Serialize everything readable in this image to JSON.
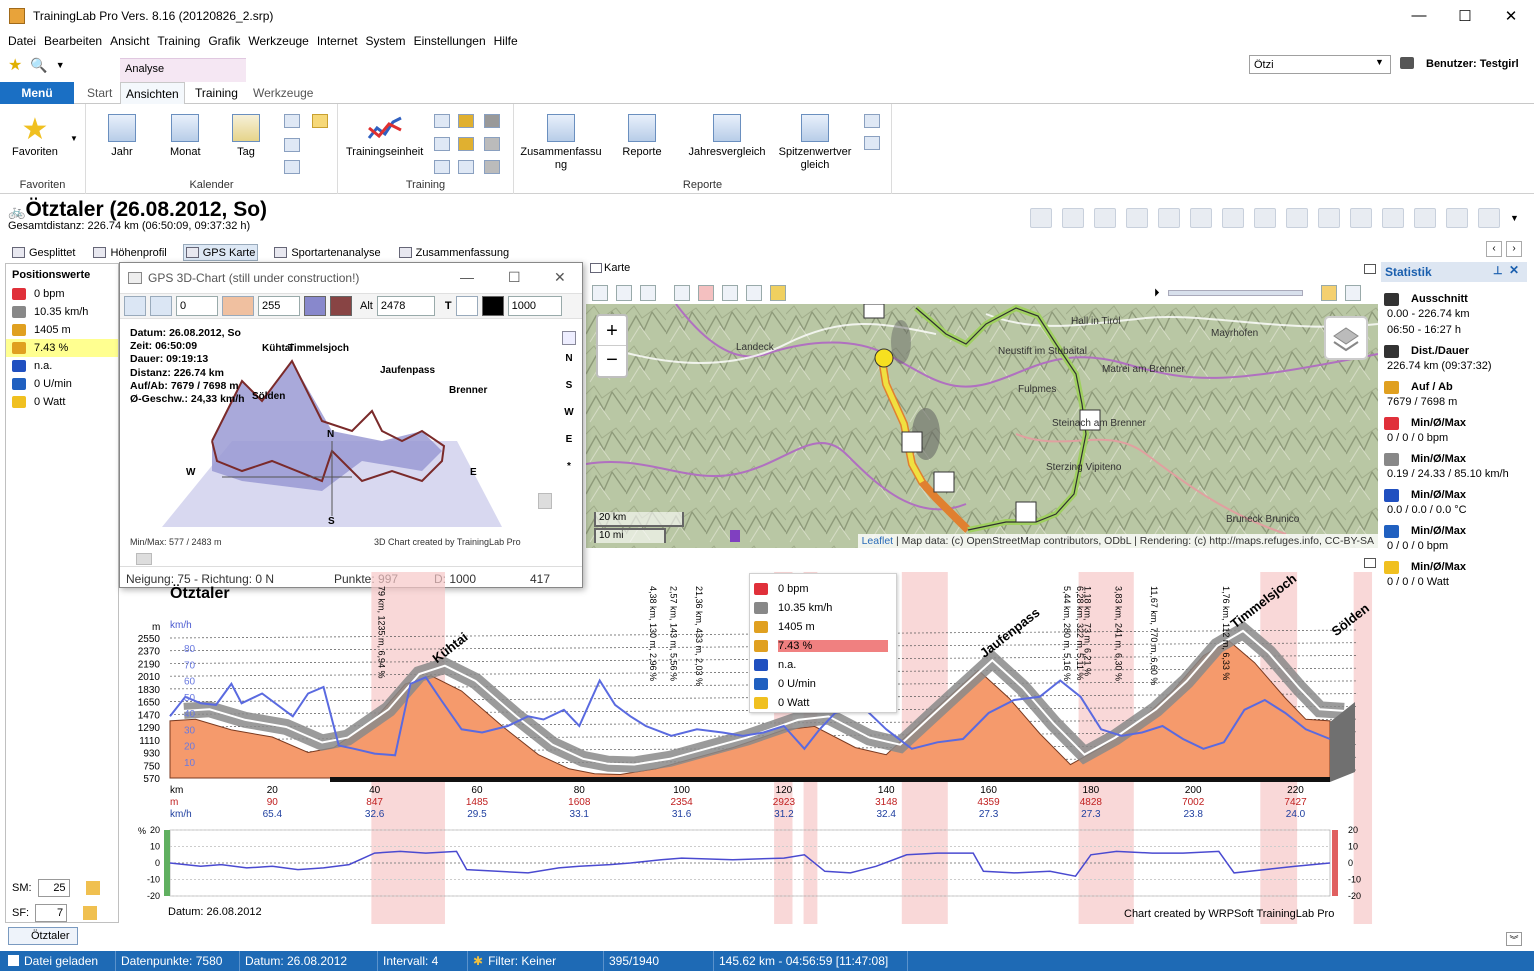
{
  "window": {
    "title": "TrainingLab Pro Vers. 8.16 (20120826_2.srp)",
    "min": "—",
    "max": "☐",
    "close": "✕"
  },
  "menu": [
    "Datei",
    "Bearbeiten",
    "Ansicht",
    "Training",
    "Grafik",
    "Werkzeuge",
    "Internet",
    "System",
    "Einstellungen",
    "Hilfe"
  ],
  "ribbon": {
    "context_tab": "Analyse",
    "menu_tab": "Menü",
    "tabs": [
      "Start",
      "Ansichten",
      "Training",
      "Werkzeuge"
    ],
    "groups": {
      "favoriten": {
        "label": "Favoriten",
        "button": "Favoriten"
      },
      "kalender": {
        "label": "Kalender",
        "buttons": [
          "Jahr",
          "Monat",
          "Tag"
        ]
      },
      "training": {
        "label": "Training",
        "button": "Trainingseinheit"
      },
      "reporte": {
        "label": "Reporte",
        "buttons": [
          "Zusammenfassu ng",
          "Reporte",
          "Jahresvergleich",
          "Spitzenwertver gleich"
        ]
      }
    },
    "athlete_combo": "Ötzi",
    "user": "Benutzer: Testgirl"
  },
  "header": {
    "title": "Ötztaler (26.08.2012, So)",
    "subtitle": "Gesamtdistanz: 226.74 km (06:50:09, 09:37:32 h)",
    "tabs": [
      "Gesplittet",
      "Höhenprofil",
      "GPS Karte",
      "Sportartenanalyse",
      "Zusammenfassung"
    ],
    "active_tab": "GPS Karte"
  },
  "positionswerte": {
    "title": "Positionswerte",
    "items": [
      {
        "icon": "heart-icon",
        "value": "0 bpm",
        "color": "#e0303a"
      },
      {
        "icon": "speedometer-icon",
        "value": "10.35 km/h",
        "color": "#888888"
      },
      {
        "icon": "altitude-icon",
        "value": "1405 m",
        "color": "#e0a020"
      },
      {
        "icon": "gradient-icon",
        "value": "7.43 %",
        "color": "#e0a020",
        "highlight": true
      },
      {
        "icon": "temperature-icon",
        "value": "n.a.",
        "color": "#2050c0"
      },
      {
        "icon": "cadence-icon",
        "value": "0 U/min",
        "color": "#2060c0"
      },
      {
        "icon": "power-icon",
        "value": "0 Watt",
        "color": "#f0c020"
      }
    ],
    "sm_label": "SM:",
    "sm_value": "25",
    "sf_label": "SF:",
    "sf_value": "7",
    "bottom_tab": "Ötztaler"
  },
  "chart3d": {
    "title": "GPS 3D-Chart (still under construction!)",
    "input1": "0",
    "input2": "255",
    "alt_label": "Alt",
    "alt_value": "2478",
    "t_label": "T",
    "size_value": "1000",
    "color1": "#8888cc",
    "color2": "#884444",
    "color3": "#000000",
    "info": [
      "Datum: 26.08.2012, So",
      "Zeit: 06:50:09",
      "Dauer: 09:19:13",
      "Distanz: 226.74 km",
      "Auf/Ab: 7679 / 7698 m",
      "Ø-Geschw.: 24,33 km/h"
    ],
    "places": [
      "Kühtai",
      "Timmelsjoch",
      "Jaufenpass",
      "Brenner",
      "Sölden"
    ],
    "compass": [
      "N",
      "W",
      "E",
      "S"
    ],
    "side_compass": [
      "N",
      "S",
      "W",
      "E",
      "*"
    ],
    "minmax": "Min/Max: 577 / 2483 m",
    "credit": "3D Chart created by TrainingLab Pro",
    "status": {
      "neigung": "Neigung: 75 - Richtung: 0 N",
      "punkte": "Punkte: 997",
      "d": "D: 1000",
      "n": "417"
    }
  },
  "map": {
    "title": "Karte",
    "zoom_in": "+",
    "zoom_out": "−",
    "scale_km": "20 km",
    "scale_mi": "10 mi",
    "places": [
      "Landeck",
      "Hall in Tirol",
      "Mayrhofen",
      "Neustift im Stubaital",
      "Fulpmes",
      "Matrei am Brenner",
      "Steinach am Brenner",
      "Sterzing Vipiteno",
      "Bruneck Brunico"
    ],
    "attribution_link": "Leaflet",
    "attribution": " | Map data: (c) OpenStreetMap contributors, ODbL | Rendering: (c) http://maps.refuges.info, CC-BY-SA"
  },
  "statistik": {
    "title": "Statistik",
    "rows": [
      {
        "label": "Ausschnitt",
        "icon": "range-icon",
        "color": "#333333",
        "values": [
          "0.00 - 226.74 km",
          "06:50 - 16:27 h"
        ]
      },
      {
        "label": "Dist./Dauer",
        "icon": "finish-flag-icon",
        "color": "#333333",
        "values": [
          "226.74 km (09:37:32)"
        ]
      },
      {
        "label": "Auf / Ab",
        "icon": "altitude-icon",
        "color": "#e0a020",
        "values": [
          "7679 / 7698 m"
        ]
      },
      {
        "label": "Min/Ø/Max",
        "icon": "heart-icon",
        "color": "#e0303a",
        "values": [
          "0 / 0 / 0 bpm"
        ]
      },
      {
        "label": "Min/Ø/Max",
        "icon": "speedometer-icon",
        "color": "#888888",
        "values": [
          "0.19 / 24.33 / 85.10 km/h"
        ]
      },
      {
        "label": "Min/Ø/Max",
        "icon": "temperature-icon",
        "color": "#2050c0",
        "values": [
          "0.0 / 0.0 / 0.0 °C"
        ]
      },
      {
        "label": "Min/Ø/Max",
        "icon": "cadence-icon",
        "color": "#2060c0",
        "values": [
          "0 / 0 / 0 bpm"
        ]
      },
      {
        "label": "Min/Ø/Max",
        "icon": "power-icon",
        "color": "#f0c020",
        "values": [
          "0 / 0 / 0 Watt"
        ]
      }
    ]
  },
  "elevation": {
    "title": "Ötztaler",
    "unit_m": "m",
    "unit_kmh": "km/h",
    "y_alt": [
      "2550",
      "2370",
      "2190",
      "2010",
      "1830",
      "1650",
      "1470",
      "1290",
      "1110",
      "930",
      "750",
      "570"
    ],
    "y_speed": [
      "80",
      "70",
      "60",
      "50",
      "40",
      "30",
      "20",
      "10"
    ],
    "x_km": [
      "20",
      "40",
      "60",
      "80",
      "100",
      "120",
      "140",
      "160",
      "180",
      "200",
      "220"
    ],
    "row_labels": [
      "km",
      "m",
      "km/h"
    ],
    "row_m": [
      "90",
      "847",
      "1485",
      "1608",
      "2354",
      "2923",
      "3148",
      "4359",
      "4828",
      "7002",
      "7427"
    ],
    "row_kmh": [
      "65.4",
      "32.6",
      "29.5",
      "33.1",
      "31.6",
      "31.2",
      "32.4",
      "27.3",
      "27.3",
      "23.8",
      "24.0"
    ],
    "passes": [
      "Kühtai",
      "Jaufenpass",
      "Timmelsjoch",
      "Sölden"
    ],
    "segments": [
      "79 km, 1235 m, 6,94 %",
      "4,38 km, 130 m, 2,96 %",
      "2,57 km, 143 m, 5,56 %",
      "21,36 km, 433 m, 2,03 %",
      "5,44 km, 280 m, 5,16 %",
      "6,28 km, 322 m, 5,11 %",
      "1,18 km, 73 m, 6,21 %",
      "3,83 km, 241 m, 6,30 %",
      "11,67 km, 770 m, 6,60 %",
      "1,76 km, 112 m, 6,33 %"
    ],
    "grad_y": [
      "20",
      "10",
      "0",
      "-10",
      "-20"
    ],
    "grad_unit": "%",
    "date": "Datum: 26.08.2012",
    "credit": "Chart created by WRPSoft TrainingLab Pro",
    "tooltip": [
      {
        "icon": "heart-icon",
        "value": "0 bpm",
        "color": "#e0303a"
      },
      {
        "icon": "speedometer-icon",
        "value": "10.35 km/h",
        "color": "#888888"
      },
      {
        "icon": "altitude-icon",
        "value": "1405 m",
        "color": "#e0a020"
      },
      {
        "icon": "gradient-icon",
        "value": "7.43 %",
        "color": "#e0a020",
        "highlight": true
      },
      {
        "icon": "temperature-icon",
        "value": "n.a.",
        "color": "#2050c0"
      },
      {
        "icon": "cadence-icon",
        "value": "0 U/min",
        "color": "#2060c0"
      },
      {
        "icon": "power-icon",
        "value": "0 Watt",
        "color": "#f0c020"
      }
    ]
  },
  "status": {
    "loaded": "Datei geladen",
    "points": "Datenpunkte: 7580",
    "date": "Datum: 26.08.2012",
    "interval": "Intervall: 4",
    "filter": "Filter: Keiner",
    "counter": "395/1940",
    "position": "145.62 km - 04:56:59 [11:47:08]"
  }
}
